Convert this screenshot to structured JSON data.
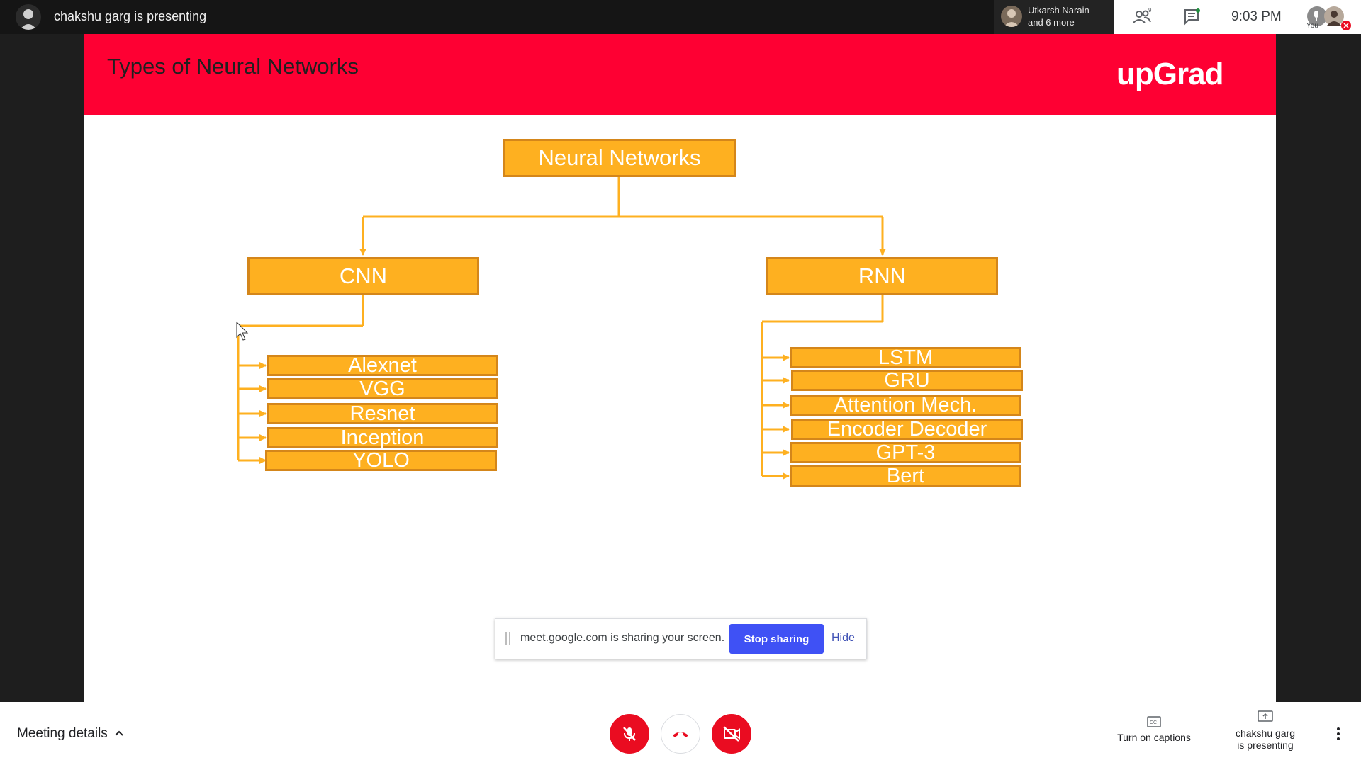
{
  "meeting": {
    "presenting_label": "chakshu garg is presenting",
    "participants_chip": {
      "name": "Utkarsh Narain",
      "more": "and 6 more"
    },
    "participant_count": "9",
    "clock": "9:03 PM",
    "self_label": "You"
  },
  "slide": {
    "title": "Types of Neural Networks",
    "brand": "upGrad",
    "root": "Neural Networks",
    "branches": [
      {
        "label": "CNN",
        "children": [
          "Alexnet",
          "VGG",
          "Resnet",
          "Inception",
          "YOLO"
        ]
      },
      {
        "label": "RNN",
        "children": [
          "LSTM",
          "GRU",
          "Attention Mech.",
          "Encoder Decoder",
          "GPT-3",
          "Bert"
        ]
      }
    ]
  },
  "share_banner": {
    "text": "meet.google.com is sharing your screen.",
    "stop_label": "Stop sharing",
    "hide_label": "Hide"
  },
  "bottom": {
    "meeting_details": "Meeting details",
    "captions": "Turn on captions",
    "presenting_line1": "chakshu garg",
    "presenting_line2": "is presenting"
  },
  "colors": {
    "header_red": "#fe0033",
    "node_fill": "#feb020",
    "node_border": "#d4861a",
    "end_call_red": "#ea0c21",
    "stop_blue": "#3f51f5"
  },
  "icons": [
    "people-icon",
    "chat-icon",
    "mic-off-icon",
    "call-end-icon",
    "camera-off-icon",
    "captions-icon",
    "present-icon",
    "more-vert-icon",
    "chevron-up-icon"
  ]
}
